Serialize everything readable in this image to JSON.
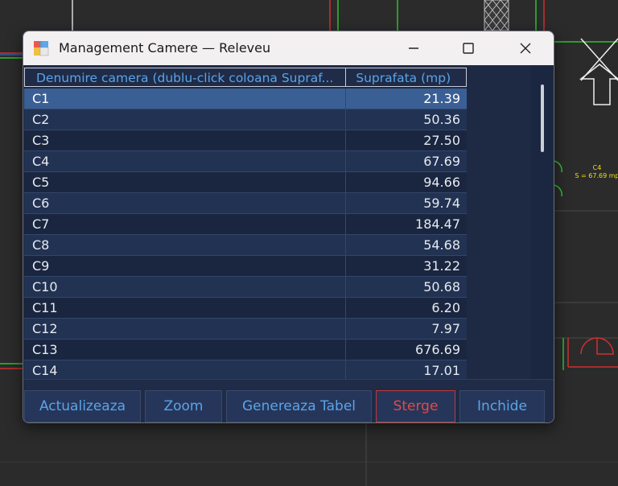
{
  "window": {
    "title": "Management Camere — Releveu"
  },
  "background_drawing": {
    "room_label": "C4",
    "room_area_label": "S = 67.69 mp"
  },
  "table": {
    "columns": [
      "Denumire camera  (dublu-click coloana Supraf...",
      "Suprafata (mp)"
    ],
    "rows": [
      {
        "name": "C1",
        "area": "21.39",
        "selected": true
      },
      {
        "name": "C2",
        "area": "50.36"
      },
      {
        "name": "C3",
        "area": "27.50"
      },
      {
        "name": "C4",
        "area": "67.69"
      },
      {
        "name": "C5",
        "area": "94.66"
      },
      {
        "name": "C6",
        "area": "59.74"
      },
      {
        "name": "C7",
        "area": "184.47"
      },
      {
        "name": "C8",
        "area": "54.68"
      },
      {
        "name": "C9",
        "area": "31.22"
      },
      {
        "name": "C10",
        "area": "50.68"
      },
      {
        "name": "C11",
        "area": "6.20"
      },
      {
        "name": "C12",
        "area": "7.97"
      },
      {
        "name": "C13",
        "area": "676.69"
      },
      {
        "name": "C14",
        "area": "17.01"
      }
    ]
  },
  "buttons": {
    "update": "Actualizeaza",
    "zoom": "Zoom",
    "generate": "Genereaza Tabel",
    "delete": "Sterge",
    "close": "Inchide"
  },
  "colors": {
    "accent": "#5aa4e8",
    "danger": "#e04b4b",
    "selected_row": "#3a5f95",
    "window_bg": "#1e2a44"
  }
}
